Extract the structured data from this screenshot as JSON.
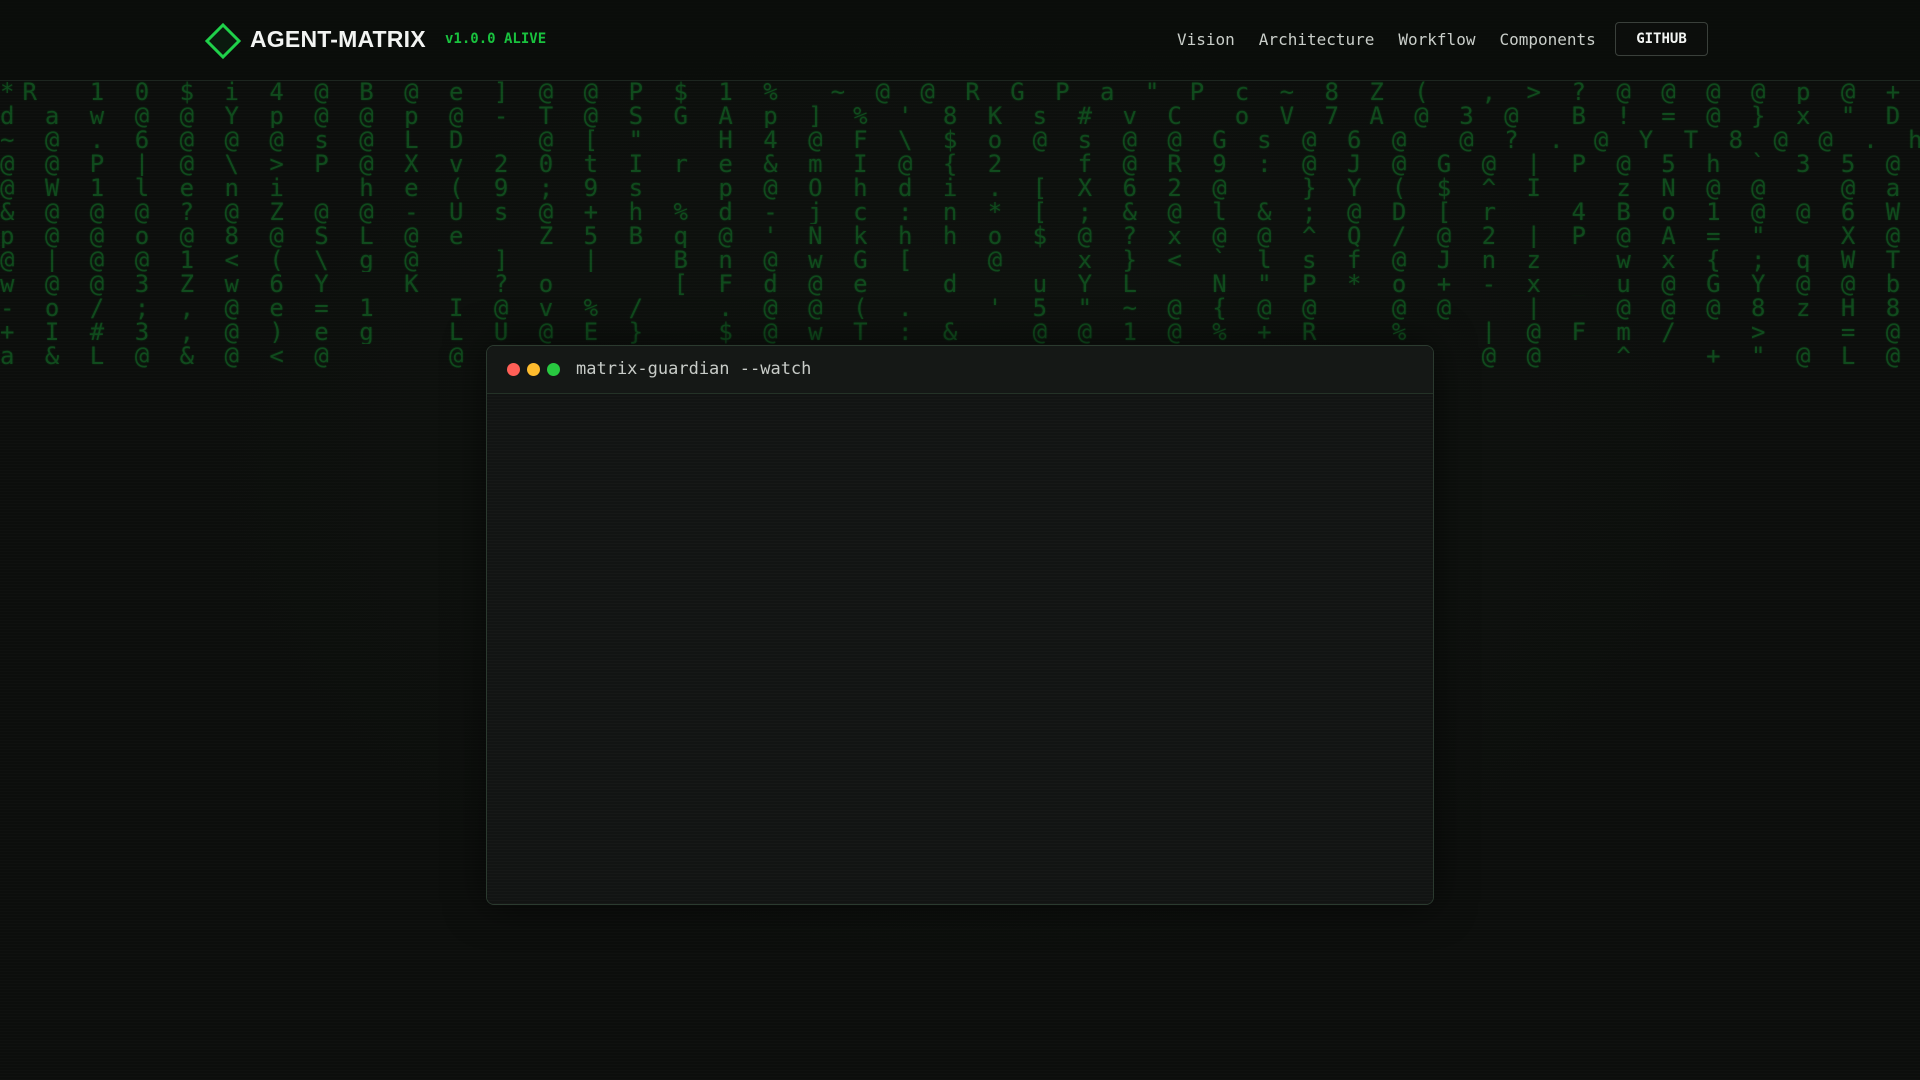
{
  "header": {
    "brand": "AGENT-MATRIX",
    "version": "v1.0.0 ALIVE",
    "nav": [
      {
        "label": "Vision"
      },
      {
        "label": "Architecture"
      },
      {
        "label": "Workflow"
      },
      {
        "label": "Components"
      }
    ],
    "github_label": "GITHUB"
  },
  "terminal": {
    "title": "matrix-guardian --watch"
  },
  "colors": {
    "accent": "#19c23e",
    "background": "#0c0e0c",
    "rain": "#0f4a1c"
  },
  "icons": {
    "logo": "diamond-logo-icon",
    "window_controls": [
      "close-dot-icon",
      "minimize-dot-icon",
      "maximize-dot-icon"
    ]
  }
}
